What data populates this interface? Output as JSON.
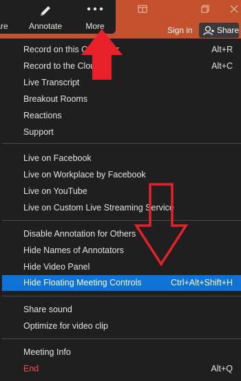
{
  "toolbar": {
    "share_partial_label": "are",
    "annotate_label": "Annotate",
    "more_label": "More"
  },
  "header": {
    "sign_in": "Sign in",
    "share": "Share"
  },
  "menu": {
    "group1": [
      {
        "label": "Record on this Computer",
        "shortcut": "Alt+R"
      },
      {
        "label": "Record to the Cloud",
        "shortcut": "Alt+C"
      },
      {
        "label": "Live Transcript",
        "shortcut": ""
      },
      {
        "label": "Breakout Rooms",
        "shortcut": ""
      },
      {
        "label": "Reactions",
        "shortcut": ""
      },
      {
        "label": "Support",
        "shortcut": ""
      }
    ],
    "group2": [
      {
        "label": "Live on Facebook"
      },
      {
        "label": "Live on Workplace by Facebook"
      },
      {
        "label": "Live on YouTube"
      },
      {
        "label": "Live on Custom Live Streaming Service"
      }
    ],
    "group3": [
      {
        "label": "Disable Annotation for Others",
        "shortcut": ""
      },
      {
        "label": "Hide Names of Annotators",
        "shortcut": ""
      },
      {
        "label": "Hide Video Panel",
        "shortcut": ""
      },
      {
        "label": "Hide Floating Meeting Controls",
        "shortcut": "Ctrl+Alt+Shift+H",
        "selected": true
      }
    ],
    "group4": [
      {
        "label": "Share sound"
      },
      {
        "label": "Optimize for video clip"
      }
    ],
    "group5": [
      {
        "label": "Meeting Info",
        "shortcut": ""
      },
      {
        "label": "End",
        "shortcut": "Alt+Q"
      }
    ]
  },
  "colors": {
    "titlebar": "#c4512d",
    "menu_bg": "#1f1f1f",
    "selected": "#0e72d8",
    "end_text": "#f05050",
    "annotation_arrow": "#e8202a"
  },
  "icons": [
    "pencil-icon",
    "more-dots-icon",
    "restore-icon",
    "maximize-icon",
    "close-icon",
    "user-icon",
    "red-up-arrow",
    "red-down-arrow-outline"
  ]
}
